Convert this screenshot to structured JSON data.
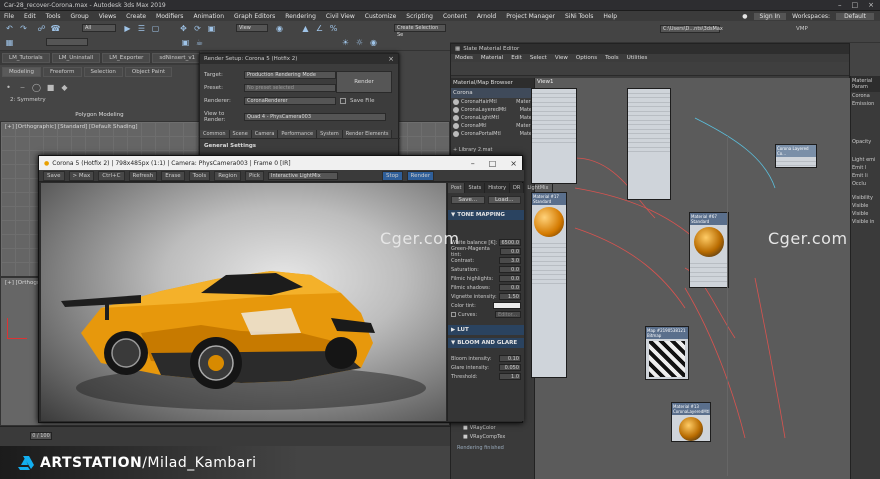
{
  "window": {
    "title": "Car-28_recover-Corona.max - Autodesk 3ds Max 2019",
    "controls": [
      "–",
      "□",
      "×"
    ]
  },
  "menu": [
    "File",
    "Edit",
    "Tools",
    "Group",
    "Views",
    "Create",
    "Modifiers",
    "Animation",
    "Graph Editors",
    "Rendering",
    "Civil View",
    "Customize",
    "Scripting",
    "Content",
    "Arnold",
    "Project Manager",
    "SiNi Tools",
    "Help"
  ],
  "menu_right": {
    "signin": "Sign In",
    "workspaces_label": "Workspaces:",
    "workspaces_value": "Default"
  },
  "toolbar": {
    "selection_filter": "All",
    "view": "View",
    "create_selection": "Create Selection Se",
    "path": "C:\\Users\\D...nts\\3dsMax",
    "vray": "VMP"
  },
  "ribbon": {
    "tabs": [
      "LM_Tutorials",
      "LM_Uninstall",
      "LM_Exporter",
      "sdNinsert_v1"
    ],
    "subtabs": [
      "Modeling",
      "Freeform",
      "Selection",
      "Object Paint"
    ],
    "symmetry": "2: Symmetry",
    "polygon_modeling": "Polygon Modeling"
  },
  "viewport_top": {
    "label": "[+] [Orthographic] [Standard] [Default Shading]"
  },
  "viewport_bottom": {
    "label": "[+] [Orthogra...]"
  },
  "render_setup": {
    "title": "Render Setup: Corona 5 (Hotfix 2)",
    "target_label": "Target:",
    "target_value": "Production Rendering Mode",
    "preset_label": "Preset:",
    "preset_value": "No preset selected",
    "renderer_label": "Renderer:",
    "renderer_value": "CoronaRenderer",
    "save_file": "Save File",
    "view_label": "View to Render:",
    "view_value": "Quad 4 - PhysCamera003",
    "render_button": "Render",
    "tabs": [
      "Common",
      "Scene",
      "Camera",
      "Performance",
      "System",
      "Render Elements"
    ],
    "section": "General Settings"
  },
  "vfb": {
    "title": "Corona 5 (Hotfix 2) | 798x485px (1:1) | Camera: PhysCamera003 | Frame 0 [IR]",
    "toolbar": [
      "Save",
      "> Max",
      "Ctrl+C",
      "Refresh",
      "Erase",
      "Tools",
      "Region",
      "Pick"
    ],
    "mode": "Interactive LightMix",
    "stop": "Stop",
    "render": "Render",
    "tabs": [
      "Post",
      "Stats",
      "History",
      "DR",
      "LightMix"
    ],
    "save_btn": "Save...",
    "load_btn": "Load...",
    "tone_mapping": "TONE MAPPING",
    "params": [
      {
        "label": "White balance [K]:",
        "value": "6500.0"
      },
      {
        "label": "Green-Magenta tint:",
        "value": "0.0"
      },
      {
        "label": "Contrast:",
        "value": "3.0"
      },
      {
        "label": "Saturation:",
        "value": "0.0"
      },
      {
        "label": "Filmic highlights:",
        "value": "0.0"
      },
      {
        "label": "Filmic shadows:",
        "value": "0.0"
      },
      {
        "label": "Vignette intensity:",
        "value": "1.50"
      },
      {
        "label": "Color tint:",
        "value": ""
      },
      {
        "label": "Curves:",
        "value": "Editor..."
      }
    ],
    "lut": "LUT",
    "bloom": "BLOOM AND GLARE",
    "bloom_params": [
      {
        "label": "Bloom intensity:",
        "value": "0.10"
      },
      {
        "label": "Glare intensity:",
        "value": "0.050"
      },
      {
        "label": "Threshold:",
        "value": "1.0"
      }
    ]
  },
  "sme": {
    "title": "Slate Material Editor",
    "menu": [
      "Modes",
      "Material",
      "Edit",
      "Select",
      "View",
      "Options",
      "Tools",
      "Utilities"
    ],
    "browser_title": "Material/Map Browser",
    "browser_items": [
      {
        "name": "CoronaHairMtl",
        "type": "Materi"
      },
      {
        "name": "CoronaLayeredMtl",
        "type": "Mate"
      },
      {
        "name": "CoronaLightMtl",
        "type": "Mate"
      },
      {
        "name": "CoronaMtl",
        "type": "Materi"
      },
      {
        "name": "CoronaPortalMtl",
        "type": "Mate"
      }
    ],
    "browser_group": "Corona",
    "library": "+ Library 2.mat",
    "view_tab": "View1",
    "vray_items": [
      "VRayColor",
      "VRayCompTex"
    ],
    "status": "Rendering finished",
    "nodes": {
      "n1_title": "Material #17 Standard",
      "n2_title": "Material #67 Standard",
      "n3_title": "Map #2190538121 Bitmap",
      "n4_title": "Material #13 CoronaLayeredMtl",
      "n5_title": "Corona Layered Co..."
    }
  },
  "right_panel": {
    "title": "Material Param",
    "items": [
      "Corona",
      "Emission",
      "Opacity",
      "Light emi",
      "Emit l",
      "Emit li",
      "Occlu",
      "Visibility",
      "Visible",
      "Visible",
      "Visible in"
    ]
  },
  "timeline": {
    "frame": "0 / 100"
  },
  "watermarks": [
    "Cger.com",
    "Cger.com"
  ],
  "banner": {
    "brand": "ARTSTATION",
    "user": "/Milad_Kambari"
  }
}
